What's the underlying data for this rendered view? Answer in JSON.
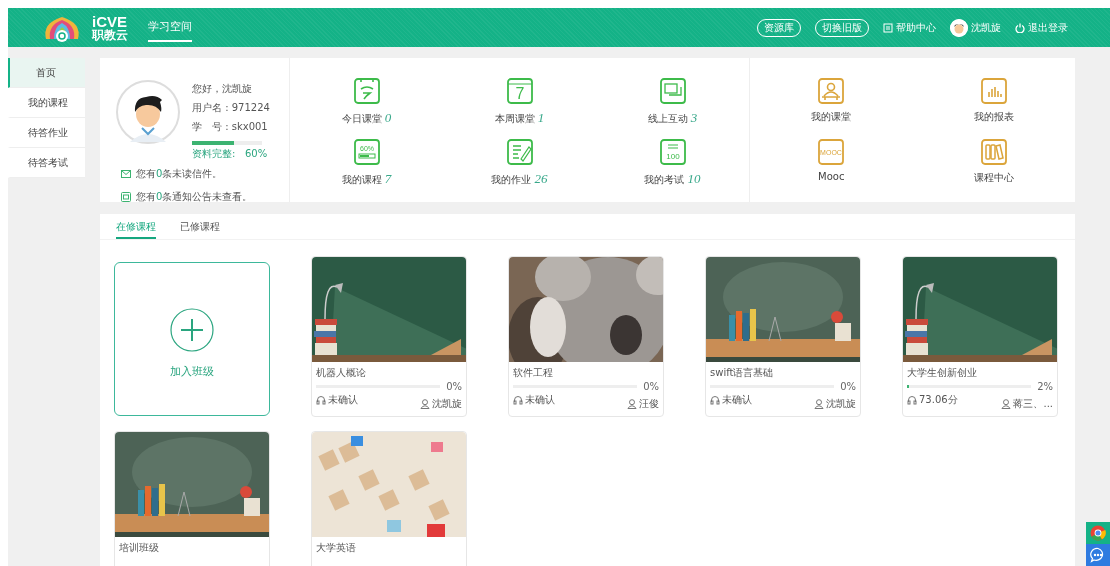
{
  "header": {
    "logo": {
      "brand": "iCVE",
      "subtitle": "职教云"
    },
    "nav": [
      {
        "label": "学习空间",
        "selected": true
      }
    ],
    "actions": [
      {
        "kind": "pill",
        "label": "资源库"
      },
      {
        "kind": "pill",
        "label": "切换旧版"
      },
      {
        "kind": "help",
        "label": "帮助中心"
      },
      {
        "kind": "user",
        "label": "沈凯旋"
      },
      {
        "kind": "logout",
        "label": "退出登录"
      }
    ]
  },
  "sidebar": {
    "items": [
      {
        "label": "首页",
        "selected": true
      },
      {
        "label": "我的课程",
        "selected": false
      },
      {
        "label": "待答作业",
        "selected": false
      },
      {
        "label": "待答考试",
        "selected": false
      }
    ]
  },
  "profile": {
    "greeting": "您好，沈凯旋",
    "username": "用户名 : 971224",
    "student_id": "学　号 : skx001",
    "completeness": {
      "label": "资料完整:   60%",
      "level": 0.6
    },
    "messages": [
      {
        "kind": "mail",
        "prefix": "您有",
        "count": "0",
        "suffix": "条未读信件。"
      },
      {
        "kind": "notice",
        "prefix": "您有",
        "count": "0",
        "suffix": "条通知公告未查看。"
      }
    ]
  },
  "stats": [
    {
      "kind": "today",
      "label": "今日课堂",
      "count": "0",
      "color": "#3dbb4a"
    },
    {
      "kind": "week",
      "badge": "7",
      "label": "本周课堂",
      "count": "1",
      "color": "#3dbb4a"
    },
    {
      "kind": "chat",
      "label": "线上互动",
      "count": "3",
      "color": "#3dbb4a"
    },
    {
      "kind": "course",
      "badge": "60%",
      "label": "我的课程",
      "count": "7",
      "color": "#3dbb4a"
    },
    {
      "kind": "homework",
      "label": "我的作业",
      "count": "26",
      "color": "#3dbb4a"
    },
    {
      "kind": "exam",
      "badge": "100",
      "label": "我的考试",
      "count": "10",
      "color": "#3dbb4a"
    }
  ],
  "shortcuts": [
    {
      "kind": "classroom",
      "label": "我的课堂",
      "color": "#dba53b"
    },
    {
      "kind": "report",
      "label": "我的报表",
      "color": "#dba53b"
    },
    {
      "kind": "mooc",
      "badge": "MOOC",
      "label": "Mooc",
      "color": "#dba53b"
    },
    {
      "kind": "library",
      "label": "课程中心",
      "color": "#dba53b"
    }
  ],
  "tabs": [
    {
      "label": "在修课程",
      "selected": true
    },
    {
      "label": "已修课程",
      "selected": false
    }
  ],
  "join_card": {
    "label": "加入班级"
  },
  "courses": [
    {
      "kind": "picture",
      "title": "机器人概论",
      "level": 0,
      "percent": "0%",
      "status": "未确认",
      "teacher": "沈凯旋"
    },
    {
      "kind": "picture",
      "title": "软件工程",
      "level": 0,
      "percent": "0%",
      "status": "未确认",
      "teacher": "汪俊"
    },
    {
      "kind": "picture",
      "title": "swift语言基础",
      "level": 0,
      "percent": "0%",
      "status": "未确认",
      "teacher": "沈凯旋"
    },
    {
      "kind": "picture",
      "title": "大学生创新创业",
      "level": 0.02,
      "percent": "2%",
      "status": "73.06分",
      "teacher": "蒋三、..."
    },
    {
      "kind": "picture",
      "title": "培训班级"
    },
    {
      "kind": "picture",
      "title": "大学英语"
    }
  ]
}
